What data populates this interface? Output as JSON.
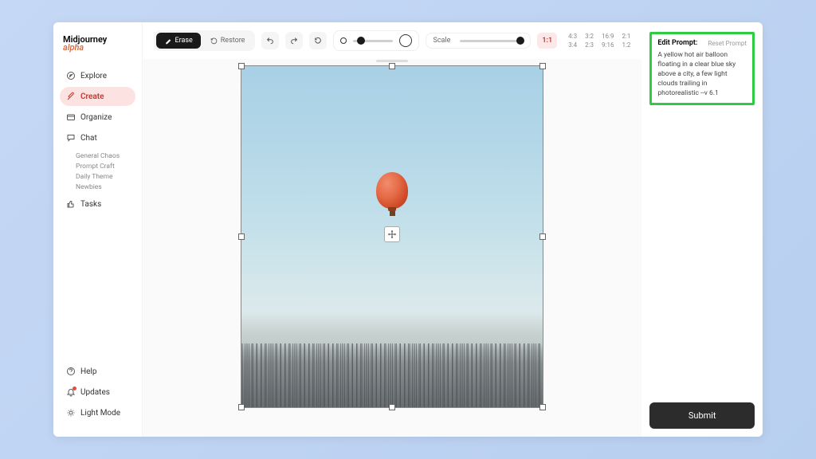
{
  "brand": {
    "name": "Midjourney",
    "suffix": "alpha"
  },
  "nav": {
    "explore": "Explore",
    "create": "Create",
    "organize": "Organize",
    "chat": "Chat",
    "tasks": "Tasks"
  },
  "chat_rooms": [
    "General Chaos",
    "Prompt Craft",
    "Daily Theme",
    "Newbies"
  ],
  "footer_nav": {
    "help": "Help",
    "updates": "Updates",
    "light": "Light Mode"
  },
  "toolbar": {
    "erase": "Erase",
    "restore": "Restore",
    "scale": "Scale",
    "aspect_active": "1:1",
    "ratios_row1": [
      "4:3",
      "3:2",
      "16:9",
      "2:1"
    ],
    "ratios_row2": [
      "3:4",
      "2:3",
      "9:16",
      "1:2"
    ]
  },
  "prompt": {
    "label": "Edit Prompt:",
    "reset": "Reset Prompt",
    "text": "A yellow hot air balloon floating in a clear blue sky above a city, a few light clouds trailing in photorealistic --v 6.1"
  },
  "submit_label": "Submit"
}
